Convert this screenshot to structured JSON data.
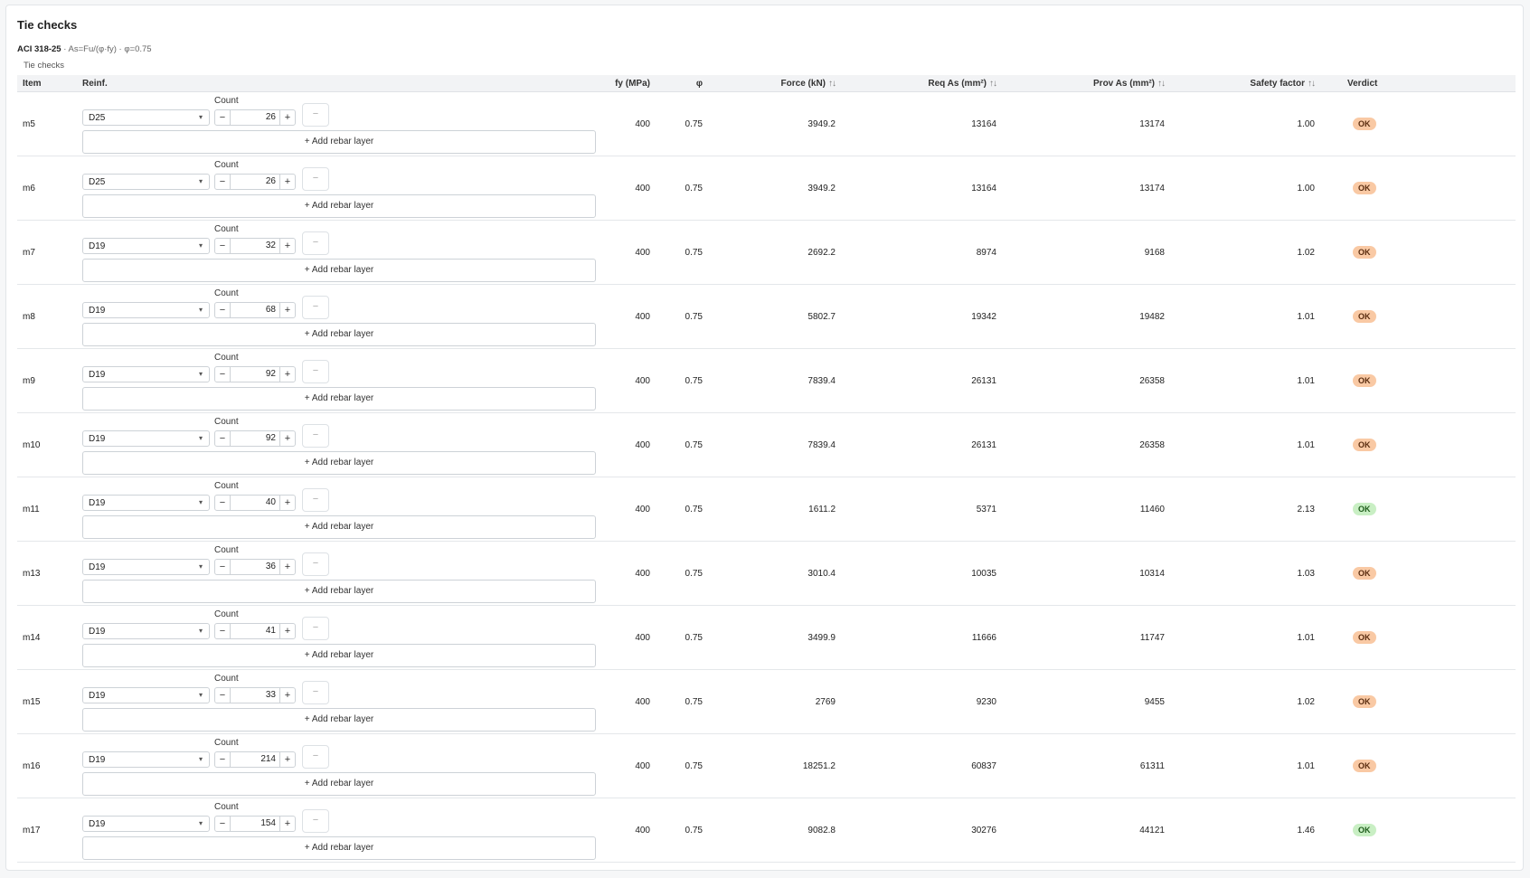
{
  "panel": {
    "title": "Tie checks",
    "code": "ACI 318-25",
    "formula": " · As=Fu/(φ·fy) · φ=0.75",
    "caption": "Tie checks"
  },
  "table": {
    "headers": {
      "item": "Item",
      "reinf": "Reinf.",
      "fy": "fy (MPa)",
      "phi": "φ",
      "force": "Force (kN)",
      "req": "Req As (mm²)",
      "prov": "Prov As (mm²)",
      "sf": "Safety factor",
      "verdict": "Verdict"
    },
    "sort_icon": "↑↓",
    "count_label": "Count",
    "minus_label": "−",
    "plus_label": "+",
    "remove_label": "−",
    "add_layer_label": "+ Add rebar layer",
    "caret": "▾",
    "rows": [
      {
        "item": "m5",
        "bar": "D25",
        "count": "26",
        "fy": "400",
        "phi": "0.75",
        "force": "3949.2",
        "req": "13164",
        "prov": "13174",
        "sf": "1.00",
        "verdict": "OK",
        "status": "warn"
      },
      {
        "item": "m6",
        "bar": "D25",
        "count": "26",
        "fy": "400",
        "phi": "0.75",
        "force": "3949.2",
        "req": "13164",
        "prov": "13174",
        "sf": "1.00",
        "verdict": "OK",
        "status": "warn"
      },
      {
        "item": "m7",
        "bar": "D19",
        "count": "32",
        "fy": "400",
        "phi": "0.75",
        "force": "2692.2",
        "req": "8974",
        "prov": "9168",
        "sf": "1.02",
        "verdict": "OK",
        "status": "warn"
      },
      {
        "item": "m8",
        "bar": "D19",
        "count": "68",
        "fy": "400",
        "phi": "0.75",
        "force": "5802.7",
        "req": "19342",
        "prov": "19482",
        "sf": "1.01",
        "verdict": "OK",
        "status": "warn"
      },
      {
        "item": "m9",
        "bar": "D19",
        "count": "92",
        "fy": "400",
        "phi": "0.75",
        "force": "7839.4",
        "req": "26131",
        "prov": "26358",
        "sf": "1.01",
        "verdict": "OK",
        "status": "warn"
      },
      {
        "item": "m10",
        "bar": "D19",
        "count": "92",
        "fy": "400",
        "phi": "0.75",
        "force": "7839.4",
        "req": "26131",
        "prov": "26358",
        "sf": "1.01",
        "verdict": "OK",
        "status": "warn"
      },
      {
        "item": "m11",
        "bar": "D19",
        "count": "40",
        "fy": "400",
        "phi": "0.75",
        "force": "1611.2",
        "req": "5371",
        "prov": "11460",
        "sf": "2.13",
        "verdict": "OK",
        "status": "ok"
      },
      {
        "item": "m13",
        "bar": "D19",
        "count": "36",
        "fy": "400",
        "phi": "0.75",
        "force": "3010.4",
        "req": "10035",
        "prov": "10314",
        "sf": "1.03",
        "verdict": "OK",
        "status": "warn"
      },
      {
        "item": "m14",
        "bar": "D19",
        "count": "41",
        "fy": "400",
        "phi": "0.75",
        "force": "3499.9",
        "req": "11666",
        "prov": "11747",
        "sf": "1.01",
        "verdict": "OK",
        "status": "warn"
      },
      {
        "item": "m15",
        "bar": "D19",
        "count": "33",
        "fy": "400",
        "phi": "0.75",
        "force": "2769",
        "req": "9230",
        "prov": "9455",
        "sf": "1.02",
        "verdict": "OK",
        "status": "warn"
      },
      {
        "item": "m16",
        "bar": "D19",
        "count": "214",
        "fy": "400",
        "phi": "0.75",
        "force": "18251.2",
        "req": "60837",
        "prov": "61311",
        "sf": "1.01",
        "verdict": "OK",
        "status": "warn"
      },
      {
        "item": "m17",
        "bar": "D19",
        "count": "154",
        "fy": "400",
        "phi": "0.75",
        "force": "9082.8",
        "req": "30276",
        "prov": "44121",
        "sf": "1.46",
        "verdict": "OK",
        "status": "ok"
      }
    ]
  }
}
